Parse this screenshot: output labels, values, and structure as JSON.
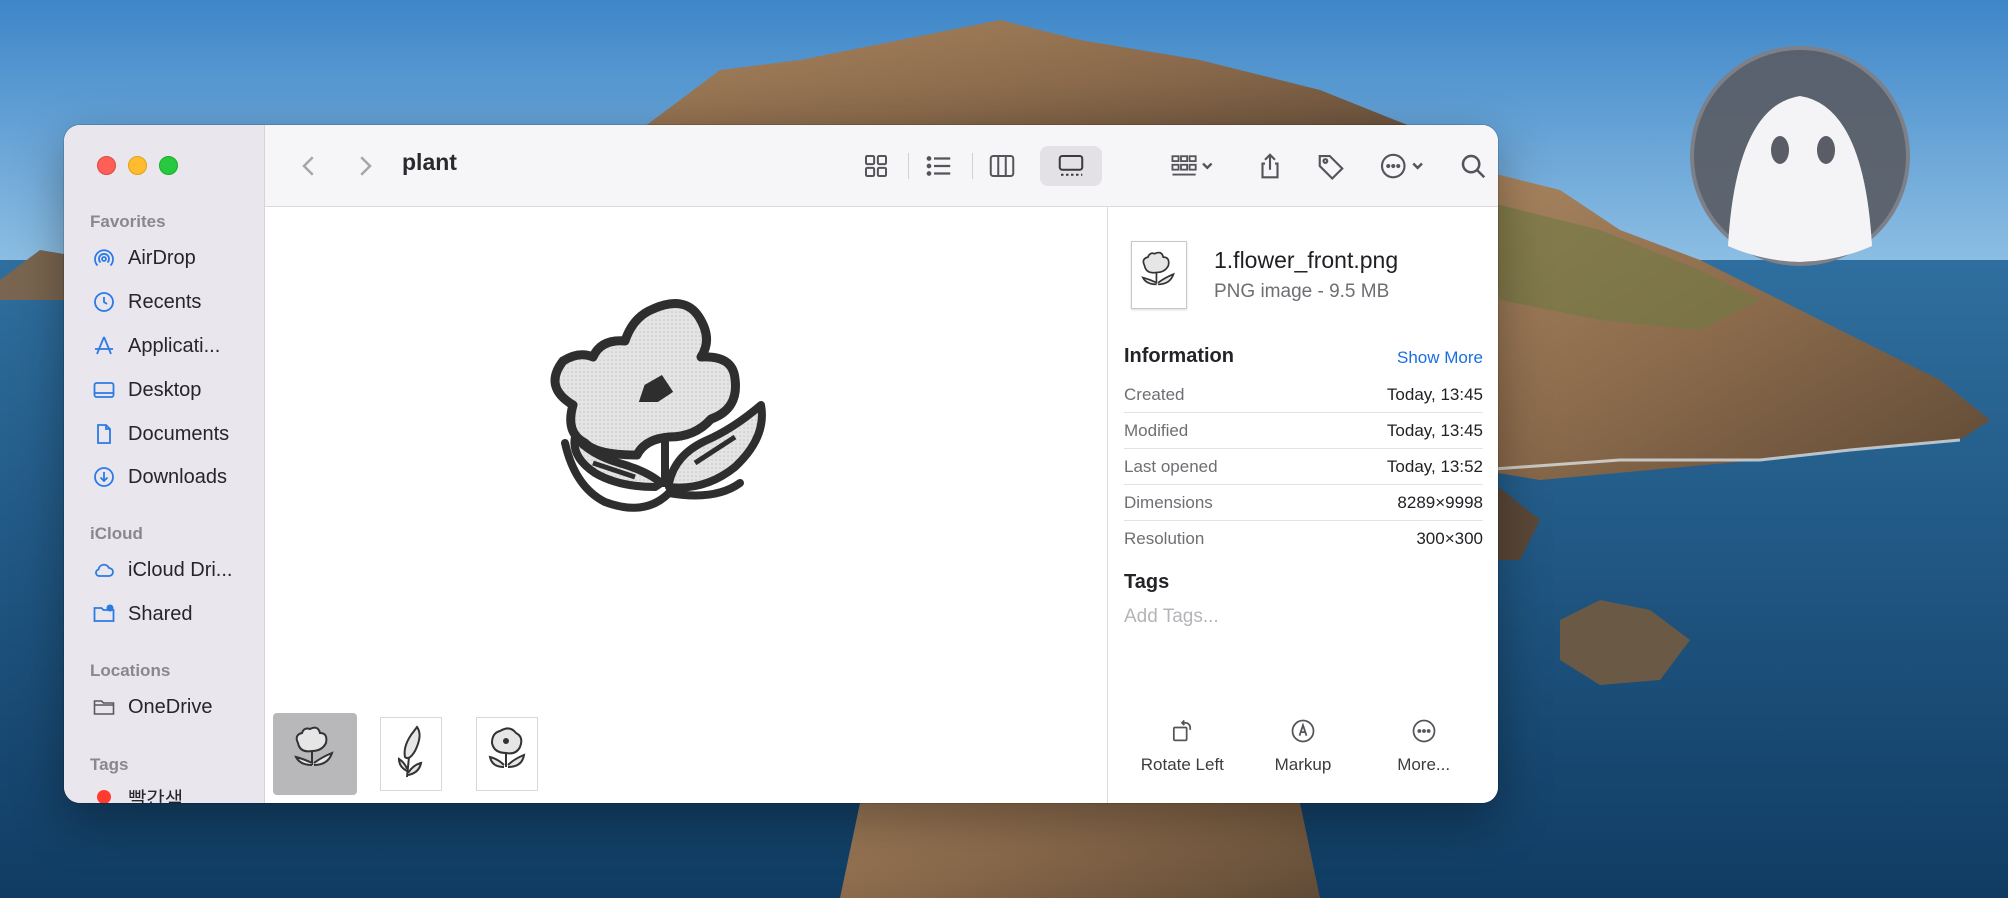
{
  "window": {
    "folder_title": "plant"
  },
  "sidebar": {
    "sections": {
      "favorites": "Favorites",
      "icloud": "iCloud",
      "locations": "Locations",
      "tags": "Tags"
    },
    "favorites": [
      {
        "label": "AirDrop",
        "icon": "airdrop-icon"
      },
      {
        "label": "Recents",
        "icon": "clock-icon"
      },
      {
        "label": "Applicati...",
        "icon": "applications-icon"
      },
      {
        "label": "Desktop",
        "icon": "desktop-icon"
      },
      {
        "label": "Documents",
        "icon": "document-icon"
      },
      {
        "label": "Downloads",
        "icon": "download-icon"
      }
    ],
    "icloud": [
      {
        "label": "iCloud Dri...",
        "icon": "cloud-icon"
      },
      {
        "label": "Shared",
        "icon": "shared-folder-icon"
      }
    ],
    "locations": [
      {
        "label": "OneDrive",
        "icon": "folder-icon"
      }
    ],
    "tags": [
      {
        "label": "빨간색",
        "color": "#ff3b30"
      }
    ]
  },
  "toolbar": {
    "icons": [
      "back-icon",
      "forward-icon",
      "icon-view-icon",
      "list-view-icon",
      "column-view-icon",
      "gallery-view-icon",
      "group-icon",
      "share-icon",
      "tag-icon",
      "more-icon",
      "search-icon"
    ]
  },
  "inspector": {
    "file_name": "1.flower_front.png",
    "file_kind": "PNG image - 9.5 MB",
    "information_heading": "Information",
    "show_more": "Show More",
    "rows": [
      {
        "key": "Created",
        "value": "Today, 13:45"
      },
      {
        "key": "Modified",
        "value": "Today, 13:45"
      },
      {
        "key": "Last opened",
        "value": "Today, 13:52"
      },
      {
        "key": "Dimensions",
        "value": "8289×9998"
      },
      {
        "key": "Resolution",
        "value": "300×300"
      }
    ],
    "tags_heading": "Tags",
    "tags_placeholder": "Add Tags...",
    "actions": [
      {
        "label": "Rotate Left",
        "icon": "rotate-left-icon"
      },
      {
        "label": "Markup",
        "icon": "markup-icon"
      },
      {
        "label": "More...",
        "icon": "more-icon"
      }
    ]
  },
  "colors": {
    "accent": "#1a6fe0",
    "close": "#fe5f57",
    "minimize": "#febc2e",
    "maximize": "#28c840",
    "tag_red": "#ff3b30"
  }
}
